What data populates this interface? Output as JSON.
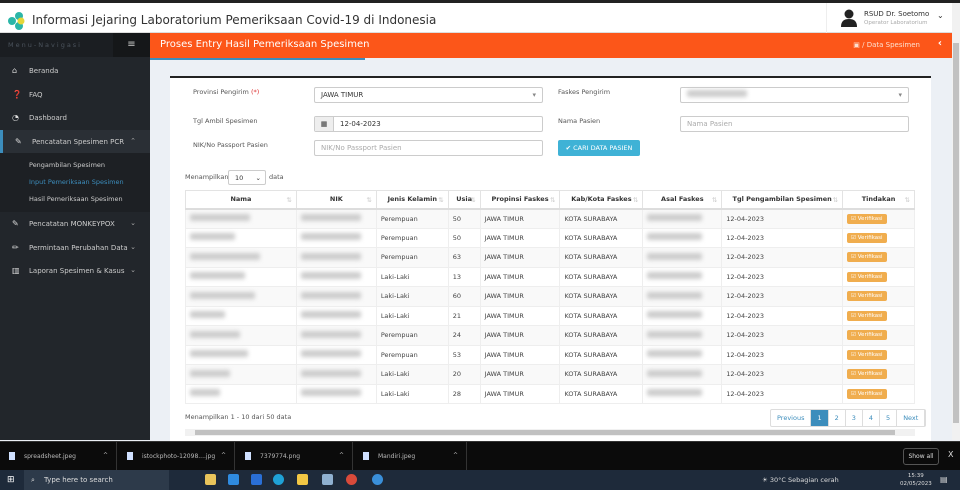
{
  "app": {
    "title": "Informasi Jejaring Laboratorium Pemeriksaan Covid-19 di Indonesia"
  },
  "user": {
    "name": "RSUD Dr. Soetomo",
    "role": "Operator Laboratorium"
  },
  "sidebar": {
    "header": "Menu-Navigasi",
    "items": [
      {
        "label": "Beranda",
        "icon": "home-icon"
      },
      {
        "label": "FAQ",
        "icon": "question-icon"
      },
      {
        "label": "Dashboard",
        "icon": "dashboard-icon"
      },
      {
        "label": "Pencatatan Spesimen PCR",
        "icon": "eyedropper-icon"
      },
      {
        "label": "Pencatatan MONKEYPOX",
        "icon": "eyedropper-icon"
      },
      {
        "label": "Permintaan Perubahan Data",
        "icon": "pencil-icon"
      },
      {
        "label": "Laporan Spesimen & Kasus",
        "icon": "bar-chart-icon"
      }
    ],
    "subitems": [
      "Pengambilan Spesimen",
      "Input Pemeriksaan Spesimen",
      "Hasil Pemeriksaan Spesimen"
    ]
  },
  "page": {
    "title": "Proses Entry Hasil Pemeriksaan Spesimen",
    "breadcrumb": "/  Data Spesimen"
  },
  "form": {
    "provinsi_label": "Provinsi Pengirim",
    "required_mark": "(*)",
    "provinsi_value": "JAWA TIMUR",
    "faskes_label": "Faskes Pengirim",
    "tgl_label": "Tgl Ambil Spesimen",
    "tgl_value": "12-04-2023",
    "nama_label": "Nama Pasien",
    "nama_placeholder": "Nama Pasien",
    "nik_label": "NIK/No Passport Pasien",
    "nik_placeholder": "NIK/No Passport Pasien",
    "search_button": "✔ CARI DATA PASIEN"
  },
  "length": {
    "prefix": "Menampilkan",
    "value": "10",
    "suffix": "data"
  },
  "table": {
    "headers": [
      "Nama",
      "NIK",
      "Jenis Kelamin",
      "Usia",
      "Propinsi Faskes",
      "Kab/Kota Faskes",
      "Asal Faskes",
      "Tgl Pengambilan Spesimen",
      "Tindakan"
    ],
    "action_label": "☑ Verifikasi",
    "rows": [
      {
        "jk": "Perempuan",
        "usia": "50",
        "prov": "JAWA TIMUR",
        "kab": "KOTA SURABAYA",
        "tgl": "12-04-2023"
      },
      {
        "jk": "Perempuan",
        "usia": "50",
        "prov": "JAWA TIMUR",
        "kab": "KOTA SURABAYA",
        "tgl": "12-04-2023"
      },
      {
        "jk": "Perempuan",
        "usia": "63",
        "prov": "JAWA TIMUR",
        "kab": "KOTA SURABAYA",
        "tgl": "12-04-2023"
      },
      {
        "jk": "Laki-Laki",
        "usia": "13",
        "prov": "JAWA TIMUR",
        "kab": "KOTA SURABAYA",
        "tgl": "12-04-2023"
      },
      {
        "jk": "Laki-Laki",
        "usia": "60",
        "prov": "JAWA TIMUR",
        "kab": "KOTA SURABAYA",
        "tgl": "12-04-2023"
      },
      {
        "jk": "Laki-Laki",
        "usia": "21",
        "prov": "JAWA TIMUR",
        "kab": "KOTA SURABAYA",
        "tgl": "12-04-2023"
      },
      {
        "jk": "Perempuan",
        "usia": "24",
        "prov": "JAWA TIMUR",
        "kab": "KOTA SURABAYA",
        "tgl": "12-04-2023"
      },
      {
        "jk": "Perempuan",
        "usia": "53",
        "prov": "JAWA TIMUR",
        "kab": "KOTA SURABAYA",
        "tgl": "12-04-2023"
      },
      {
        "jk": "Laki-Laki",
        "usia": "20",
        "prov": "JAWA TIMUR",
        "kab": "KOTA SURABAYA",
        "tgl": "12-04-2023"
      },
      {
        "jk": "Laki-Laki",
        "usia": "28",
        "prov": "JAWA TIMUR",
        "kab": "KOTA SURABAYA",
        "tgl": "12-04-2023"
      }
    ]
  },
  "info": "Menampilkan 1 - 10 dari 50 data",
  "pagination": [
    "Previous",
    "1",
    "2",
    "3",
    "4",
    "5",
    "Next"
  ],
  "downloads": {
    "files": [
      "spreadsheet.jpeg",
      "istockphoto-12098....jpg",
      "7379774.png",
      "Mandiri.jpeg"
    ],
    "show_all": "Show all",
    "close": "X"
  },
  "taskbar": {
    "search": "Type here to search",
    "weather": "30°C  Sebagian cerah",
    "time": "15:39",
    "date": "02/05/2023"
  }
}
